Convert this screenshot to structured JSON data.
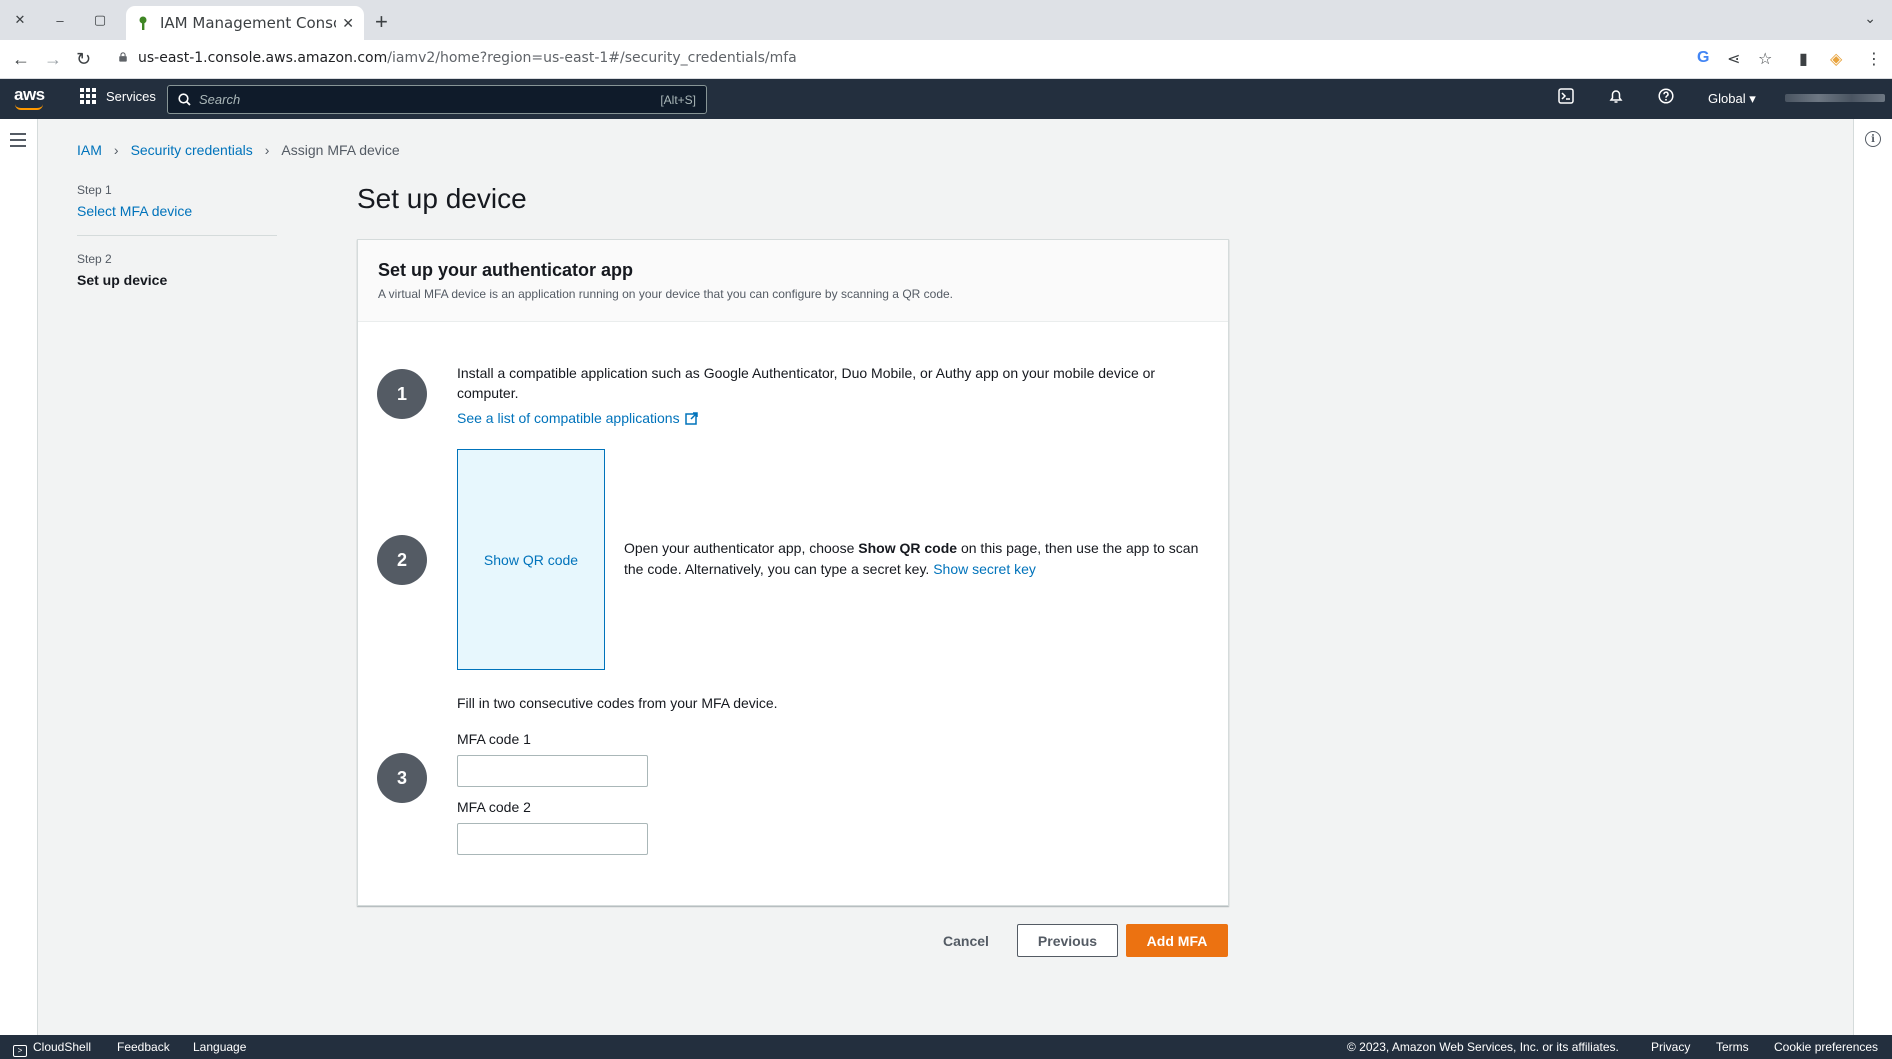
{
  "browser": {
    "tab_title": "IAM Management Console",
    "new_tab": "+",
    "url_host": "us-east-1.console.aws.amazon.com",
    "url_path": "/iamv2/home?region=us-east-1#/security_credentials/mfa"
  },
  "aws_nav": {
    "logo": "aws",
    "services_label": "Services",
    "search_placeholder": "Search",
    "search_shortcut": "[Alt+S]",
    "region_label": "Global ▾"
  },
  "breadcrumb": {
    "items": [
      "IAM",
      "Security credentials",
      "Assign MFA device"
    ]
  },
  "wizard": {
    "steps": [
      {
        "step": "Step 1",
        "label": "Select MFA device"
      },
      {
        "step": "Step 2",
        "label": "Set up device"
      }
    ]
  },
  "main": {
    "page_title": "Set up device",
    "panel_title": "Set up your authenticator app",
    "panel_desc": "A virtual MFA device is an application running on your device that you can configure by scanning a QR code.",
    "step1": {
      "number": "1",
      "text": "Install a compatible application such as Google Authenticator, Duo Mobile, or Authy app on your mobile device or computer.",
      "link": "See a list of compatible applications"
    },
    "step2": {
      "number": "2",
      "qr_button": "Show QR code",
      "text_a": "Open your authenticator app, choose ",
      "text_bold": "Show QR code",
      "text_b": " on this page, then use the app to scan the code. Alternatively, you can type a secret key. ",
      "secret_link": "Show secret key"
    },
    "step3": {
      "number": "3",
      "intro": "Fill in two consecutive codes from your MFA device.",
      "code1_label": "MFA code 1",
      "code1_value": "",
      "code2_label": "MFA code 2",
      "code2_value": ""
    }
  },
  "actions": {
    "cancel": "Cancel",
    "previous": "Previous",
    "add_mfa": "Add MFA"
  },
  "footer": {
    "cloudshell": "CloudShell",
    "feedback": "Feedback",
    "language": "Language",
    "copyright": "© 2023, Amazon Web Services, Inc. or its affiliates.",
    "privacy": "Privacy",
    "terms": "Terms",
    "cookie": "Cookie preferences"
  }
}
